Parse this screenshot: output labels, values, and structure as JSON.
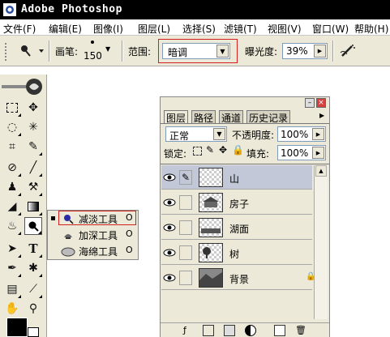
{
  "app": {
    "title": "Adobe Photoshop"
  },
  "menu": [
    "文件(F)",
    "编辑(E)",
    "图像(I)",
    "图层(L)",
    "选择(S)",
    "滤镜(T)",
    "视图(V)",
    "窗口(W)",
    "帮助(H)"
  ],
  "options": {
    "brush_label": "画笔:",
    "brush_size": "150",
    "range_label": "范围:",
    "range_value": "暗调",
    "exposure_label": "曝光度:",
    "exposure_value": "39%"
  },
  "flyout": {
    "items": [
      {
        "label": "减淡工具",
        "key": "O",
        "selected": true
      },
      {
        "label": "加深工具",
        "key": "O",
        "selected": false
      },
      {
        "label": "海绵工具",
        "key": "O",
        "selected": false
      }
    ]
  },
  "layers_panel": {
    "tabs": [
      "图层",
      "路径",
      "通道",
      "历史记录"
    ],
    "blend_mode": "正常",
    "opacity_label": "不透明度:",
    "opacity_value": "100%",
    "lock_label": "锁定:",
    "fill_label": "填充:",
    "fill_value": "100%",
    "layers": [
      {
        "name": "山",
        "selected": true,
        "locked": false
      },
      {
        "name": "房子",
        "selected": false,
        "locked": false
      },
      {
        "name": "湖面",
        "selected": false,
        "locked": false
      },
      {
        "name": "树",
        "selected": false,
        "locked": false
      },
      {
        "name": "背景",
        "selected": false,
        "locked": true
      }
    ]
  },
  "colors": {
    "selection_outline": "#d02020",
    "selected_layer": "#c3c8d8"
  }
}
